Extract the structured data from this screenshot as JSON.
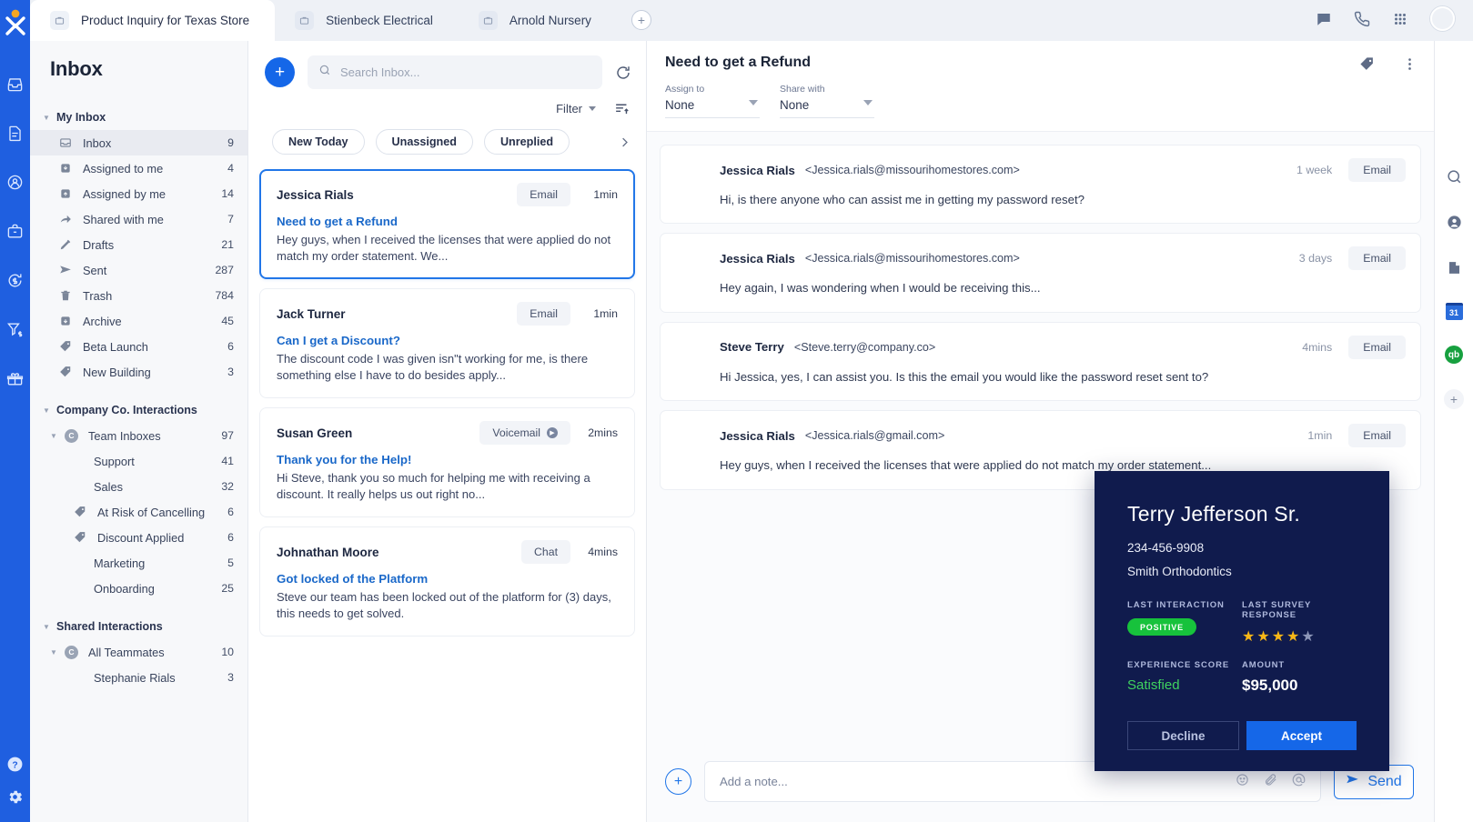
{
  "app": {
    "logo_icon": "x-logo-icon",
    "rail_icons": [
      "inbox-icon",
      "document-icon",
      "contact-icon",
      "briefcase-icon",
      "dollar-refresh-icon",
      "funnel-dollar-icon",
      "gift-icon"
    ],
    "rail_bottom_icons": [
      "help-icon",
      "gear-icon"
    ]
  },
  "tabs": [
    {
      "label": "Product Inquiry for Texas Store",
      "icon": "briefcase-icon",
      "active": true
    },
    {
      "label": "Stienbeck Electrical",
      "icon": "briefcase-icon",
      "active": false
    },
    {
      "label": "Arnold Nursery",
      "icon": "briefcase-icon",
      "active": false
    }
  ],
  "tabbar": {
    "add_tab_label": "+",
    "icons": [
      "chat-icon",
      "phone-icon",
      "apps-grid-icon"
    ],
    "avatar": "user-avatar"
  },
  "sidebar": {
    "title": "Inbox",
    "groups": [
      {
        "label": "My Inbox",
        "items": [
          {
            "label": "Inbox",
            "count": "9",
            "icon": "inbox-icon",
            "active": true,
            "indent": 1
          },
          {
            "label": "Assigned to me",
            "count": "4",
            "icon": "assigned-to-icon",
            "active": false,
            "indent": 1
          },
          {
            "label": "Assigned by me",
            "count": "14",
            "icon": "assigned-by-icon",
            "active": false,
            "indent": 1
          },
          {
            "label": "Shared with me",
            "count": "7",
            "icon": "share-arrow-icon",
            "active": false,
            "indent": 1
          },
          {
            "label": "Drafts",
            "count": "21",
            "icon": "pencil-icon",
            "active": false,
            "indent": 1
          },
          {
            "label": "Sent",
            "count": "287",
            "icon": "send-icon",
            "active": false,
            "indent": 1
          },
          {
            "label": "Trash",
            "count": "784",
            "icon": "trash-icon",
            "active": false,
            "indent": 1
          },
          {
            "label": "Archive",
            "count": "45",
            "icon": "archive-icon",
            "active": false,
            "indent": 1
          },
          {
            "label": "Beta Launch",
            "count": "6",
            "icon": "tag-icon",
            "active": false,
            "indent": 1
          },
          {
            "label": "New Building",
            "count": "3",
            "icon": "tag-icon",
            "active": false,
            "indent": 1
          }
        ]
      },
      {
        "label": "Company Co. Interactions",
        "items": [
          {
            "label": "Team Inboxes",
            "count": "97",
            "icon": "group-avatar-c",
            "active": false,
            "indent": 2,
            "caret": true
          },
          {
            "label": "Support",
            "count": "41",
            "icon": "",
            "active": false,
            "indent": 3
          },
          {
            "label": "Sales",
            "count": "32",
            "icon": "",
            "active": false,
            "indent": 3
          },
          {
            "label": "At Risk of Cancelling",
            "count": "6",
            "icon": "tag-icon",
            "active": false,
            "indent": 2
          },
          {
            "label": "Discount Applied",
            "count": "6",
            "icon": "tag-icon",
            "active": false,
            "indent": 2
          },
          {
            "label": "Marketing",
            "count": "5",
            "icon": "",
            "active": false,
            "indent": 3
          },
          {
            "label": "Onboarding",
            "count": "25",
            "icon": "",
            "active": false,
            "indent": 3
          }
        ]
      },
      {
        "label": "Shared Interactions",
        "items": [
          {
            "label": "All Teammates",
            "count": "10",
            "icon": "group-avatar-c",
            "active": false,
            "indent": 2,
            "caret": true
          },
          {
            "label": "Stephanie Rials",
            "count": "3",
            "icon": "",
            "active": false,
            "indent": 3
          }
        ]
      }
    ]
  },
  "conversation_list": {
    "compose_label": "+",
    "search_placeholder": "Search Inbox...",
    "search_value": "",
    "refresh_icon": "refresh-icon",
    "filter_label": "Filter",
    "sort_icon": "sort-ascending-icon",
    "chips": [
      "New Today",
      "Unassigned",
      "Unreplied"
    ],
    "chips_next_icon": "chevron-right-icon",
    "items": [
      {
        "name": "Jessica Rials",
        "channel": "Email",
        "time": "1min",
        "subject": "Need to get a Refund",
        "snippet": "Hey guys, when I received the licenses that were applied do not match my order statement. We...",
        "selected": true,
        "voicemail": false
      },
      {
        "name": "Jack Turner",
        "channel": "Email",
        "time": "1min",
        "subject": "Can I get a Discount?",
        "snippet": "The discount code I was given isn\"t working for me, is there something else I have to do besides apply...",
        "selected": false,
        "voicemail": false
      },
      {
        "name": "Susan Green",
        "channel": "Voicemail",
        "time": "2mins",
        "subject": "Thank you for the Help!",
        "snippet": "Hi Steve, thank you so much for helping me with receiving a discount. It really helps us out right no...",
        "selected": false,
        "voicemail": true
      },
      {
        "name": "Johnathan Moore",
        "channel": "Chat",
        "time": "4mins",
        "subject": "Got locked of the Platform",
        "snippet": "Steve our team has been locked out of the platform for (3) days, this needs to get solved.",
        "selected": false,
        "voicemail": false
      }
    ]
  },
  "detail": {
    "title": "Need to get a Refund",
    "tag_icon": "tag-icon",
    "menu_icon": "kebab-menu-icon",
    "assign_to": {
      "label": "Assign to",
      "value": "None"
    },
    "share_with": {
      "label": "Share with",
      "value": "None"
    },
    "messages": [
      {
        "name": "Jessica Rials",
        "email": "<Jessica.rials@missourihomestores.com>",
        "time": "1 week",
        "channel": "Email",
        "body": "Hi, is there anyone who can assist me in getting my password reset?",
        "avatar": "f-jessica"
      },
      {
        "name": "Jessica Rials",
        "email": "<Jessica.rials@missourihomestores.com>",
        "time": "3 days",
        "channel": "Email",
        "body": "Hey again, I was wondering when I would be receiving this...",
        "avatar": "f-jessica"
      },
      {
        "name": "Steve Terry",
        "email": "<Steve.terry@company.co>",
        "time": "4mins",
        "channel": "Email",
        "body": "Hi Jessica, yes, I can assist you.  Is this the email you would like the password reset sent to?",
        "avatar": "f-steve"
      },
      {
        "name": "Jessica Rials",
        "email": "<Jessica.rials@gmail.com>",
        "time": "1min",
        "channel": "Email",
        "body": "Hey guys, when I received the licenses that were applied do not match my order statement...",
        "avatar": "f-jessica"
      }
    ],
    "composer": {
      "add_label": "+",
      "placeholder": "Add a note...",
      "value": "",
      "tool_icons": [
        "emoji-icon",
        "attachment-icon",
        "mention-icon"
      ],
      "send_label": "Send"
    }
  },
  "right_rail": {
    "icons": [
      "search-icon",
      "contact-icon",
      "file-icon"
    ],
    "calendar_label": "31",
    "quickbooks_label": "qb",
    "add_label": "+"
  },
  "contact_card": {
    "name": "Terry Jefferson Sr.",
    "phone": "234-456-9908",
    "company": "Smith Orthodontics",
    "last_interaction_label": "LAST INTERACTION",
    "last_interaction_value": "POSITIVE",
    "last_survey_label": "LAST SURVEY RESPONSE",
    "stars_filled": 4,
    "stars_total": 5,
    "experience_label": "EXPERIENCE SCORE",
    "experience_value": "Satisfied",
    "amount_label": "AMOUNT",
    "amount_value": "$95,000",
    "decline_label": "Decline",
    "accept_label": "Accept"
  },
  "colors": {
    "brand_blue": "#1f5fe0",
    "accent_blue": "#1567e8",
    "card_navy": "#101b4d",
    "positive_green": "#17c23c",
    "star_gold": "#f7b617"
  }
}
